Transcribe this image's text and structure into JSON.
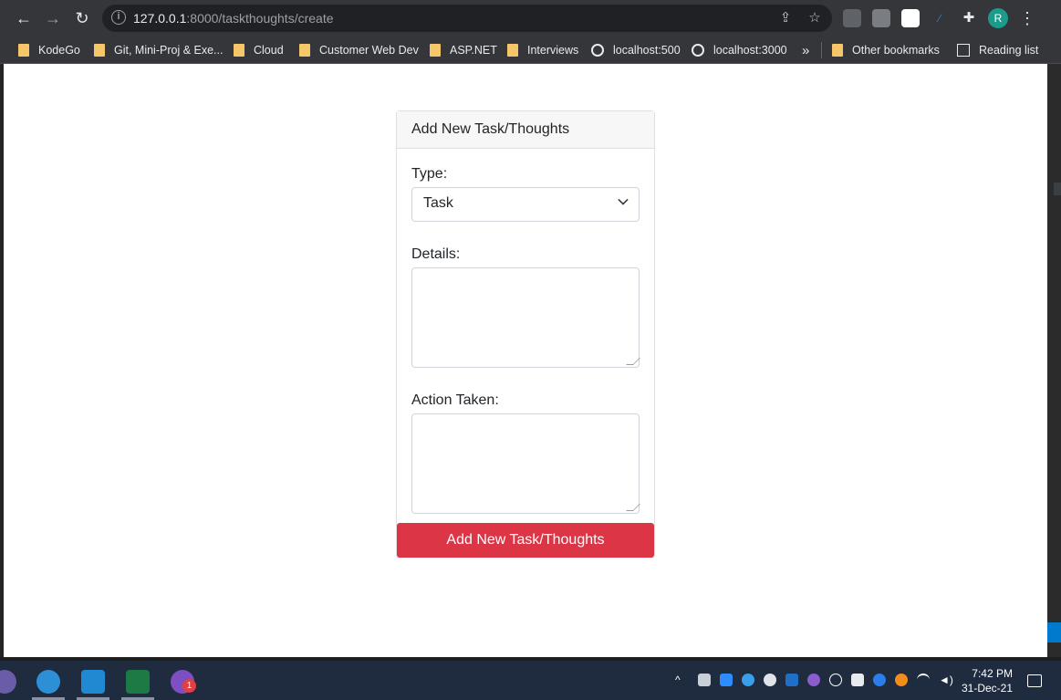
{
  "browser": {
    "url_host": "127.0.0.1",
    "url_path": ":8000/taskthoughts/create",
    "profile_initial": "R",
    "bookmarks": [
      {
        "label": "KodeGo",
        "type": "folder"
      },
      {
        "label": "Git, Mini-Proj & Exe...",
        "type": "folder"
      },
      {
        "label": "Cloud",
        "type": "folder"
      },
      {
        "label": "Customer Web Dev",
        "type": "folder"
      },
      {
        "label": "ASP.NET",
        "type": "folder"
      },
      {
        "label": "Interviews",
        "type": "folder"
      },
      {
        "label": "localhost:500",
        "type": "link"
      },
      {
        "label": "localhost:3000",
        "type": "link"
      }
    ],
    "overflow_label": "»",
    "other_bookmarks": "Other bookmarks",
    "reading_list": "Reading list"
  },
  "form": {
    "header": "Add New Task/Thoughts",
    "type_label": "Type:",
    "type_value": "Task",
    "details_label": "Details:",
    "action_label": "Action Taken:",
    "submit_label": "Add New Task/Thoughts"
  },
  "taskbar": {
    "time": "7:42 PM",
    "date": "31-Dec-21",
    "viber_badge": "1"
  },
  "colors": {
    "submit_bg": "#dc3545",
    "folder": "#f5c76a",
    "taskbar": "#1f2b3e"
  }
}
